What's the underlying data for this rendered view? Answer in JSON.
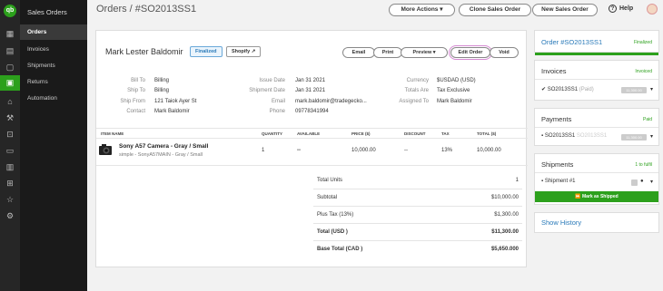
{
  "app": {
    "title": "Sales Orders"
  },
  "nav": {
    "items": [
      {
        "label": "Orders"
      },
      {
        "label": "Invoices"
      },
      {
        "label": "Shipments"
      },
      {
        "label": "Returns"
      },
      {
        "label": "Automation"
      }
    ]
  },
  "breadcrumb": {
    "text": "Orders / #SO2013SS1"
  },
  "toolbar": {
    "more_actions": "More Actions",
    "clone": "Clone Sales Order",
    "new": "New Sales Order",
    "help": "Help"
  },
  "order": {
    "customer": "Mark Lester Baldomir",
    "status_tag": "Finalized",
    "shopify_tag": "Shopify",
    "actions": {
      "email": "Email",
      "print": "Print",
      "preview": "Preview",
      "edit": "Edit Order",
      "void": "Void"
    },
    "fields": {
      "bill_to_label": "Bill To",
      "bill_to": "Billing",
      "ship_to_label": "Ship To",
      "ship_to": "Billing",
      "ship_from_label": "Ship From",
      "ship_from": "121 Taiok Ayer St",
      "contact_label": "Contact",
      "contact": "Mark Baldomir",
      "issue_date_label": "Issue Date",
      "issue_date": "Jan 31 2021",
      "shipment_date_label": "Shipment Date",
      "shipment_date": "Jan 31 2021",
      "email_label": "Email",
      "email": "mark.baldomir@tradegecko...",
      "phone_label": "Phone",
      "phone": "09778341994",
      "currency_label": "Currency",
      "currency": "$USDAD (USD)",
      "totals_label": "Totals Are",
      "totals": "Tax Exclusive",
      "assigned_label": "Assigned To",
      "assigned": "Mark Baldomir"
    },
    "table": {
      "headers": [
        "ITEM NAME",
        "QUANTITY",
        "AVAILABLE",
        "PRICE ($)",
        "DISCOUNT",
        "TAX",
        "TOTAL ($)"
      ],
      "row": {
        "name": "Sony A57 Camera - Gray / Small",
        "sub": "simple - SonyA57MAIN - Gray / Small",
        "qty": "1",
        "available": "--",
        "price": "10,000.00",
        "discount": "--",
        "tax": "13%",
        "total": "10,000.00"
      }
    },
    "totals_rows": [
      {
        "label": "Total Units",
        "value": "1"
      },
      {
        "label": "Subtotal",
        "value": "$10,000.00"
      },
      {
        "label": "Plus Tax (13%)",
        "value": "$1,300.00"
      },
      {
        "label": "Total (USD )",
        "value": "$11,300.00"
      },
      {
        "label": "Base Total (CAD )",
        "value": "$5,650.000"
      }
    ]
  },
  "panels": {
    "order": {
      "title": "Order #SO2013SS1",
      "status": "Finalized"
    },
    "invoices": {
      "title": "Invoices",
      "status": "Invoiced",
      "item": "SO2013SS1",
      "item_status": "(Paid)",
      "amount": "11,300.00"
    },
    "payments": {
      "title": "Payments",
      "status": "Paid",
      "item": "SO2013SS1",
      "item_ghost": "SO2013SS1",
      "amount": "11,300.00"
    },
    "shipments": {
      "title": "Shipments",
      "status": "1 to fulfil",
      "item": "Shipment #1",
      "mark": "Mark as Shipped"
    },
    "history": {
      "title": "Show History"
    }
  },
  "colors": {
    "brand": "#2ca01c",
    "link": "#2a7ab9"
  }
}
